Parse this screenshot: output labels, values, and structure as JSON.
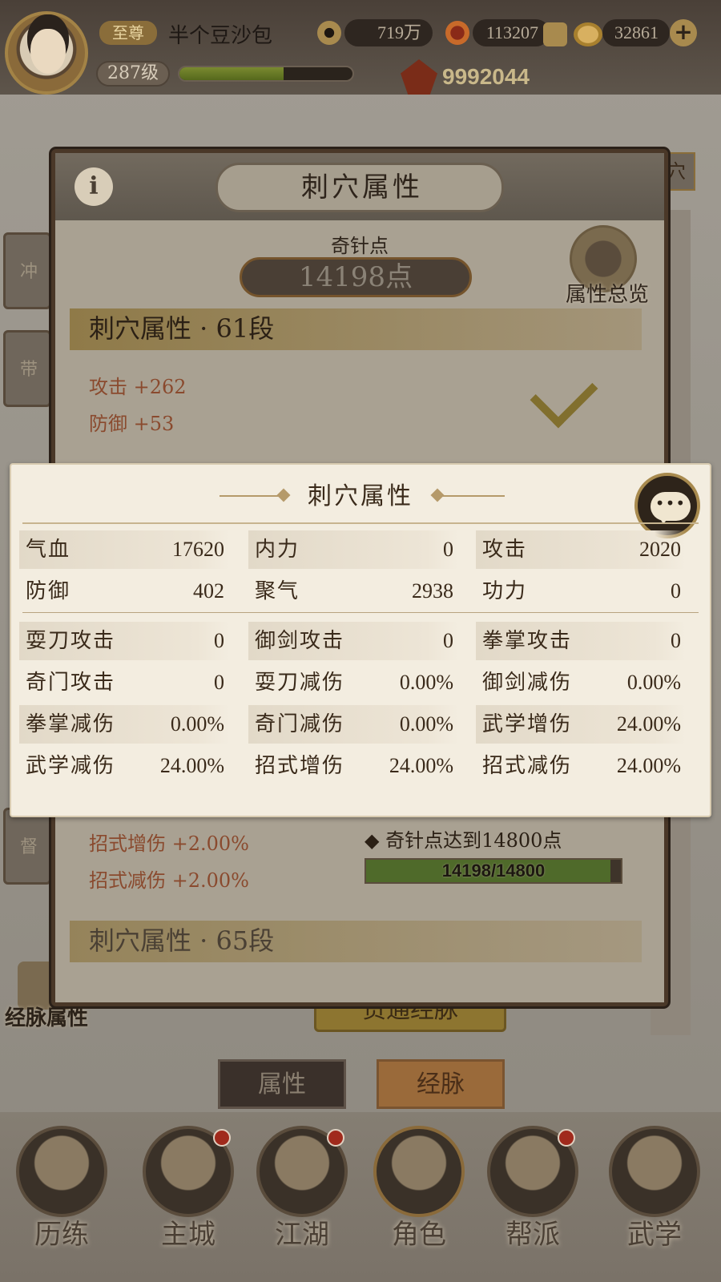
{
  "player": {
    "vip": "至尊",
    "name": "半个豆沙包",
    "level": "287级",
    "exp_fraction": 0.6,
    "copper": "719万",
    "jade": "113207",
    "gold": "32861",
    "power": "9992044"
  },
  "side": {
    "right_tab": "穴",
    "meridian_attr": "经脉属性",
    "activate_btn": "贯通经脉"
  },
  "bottom_tabs": {
    "attr": "属性",
    "meridian": "经脉"
  },
  "nav": [
    {
      "label": "历练",
      "dot": false
    },
    {
      "label": "主城",
      "dot": true
    },
    {
      "label": "江湖",
      "dot": true
    },
    {
      "label": "角色",
      "dot": false
    },
    {
      "label": "帮派",
      "dot": true
    },
    {
      "label": "武学",
      "dot": false
    }
  ],
  "dialog": {
    "title": "刺穴属性",
    "points_caption": "奇针点",
    "points_value": "14198点",
    "overview": "属性总览",
    "tier61": {
      "header": "刺穴属性 · 61段",
      "stat1": "攻击 +262",
      "stat2": "防御 +53"
    },
    "tier_mid": {
      "stat1": "招式增伤 +2.00%",
      "stat2": "招式减伤 +2.00%",
      "requirement": "◆ 奇针点达到14800点",
      "progress": "14198/14800",
      "progress_fraction": 0.959
    },
    "tier65": {
      "header": "刺穴属性 · 65段"
    }
  },
  "popup": {
    "title": "刺穴属性",
    "rows": [
      [
        {
          "name": "气血",
          "value": "17620"
        },
        {
          "name": "内力",
          "value": "0"
        },
        {
          "name": "攻击",
          "value": "2020"
        }
      ],
      [
        {
          "name": "防御",
          "value": "402"
        },
        {
          "name": "聚气",
          "value": "2938"
        },
        {
          "name": "功力",
          "value": "0"
        }
      ],
      [
        {
          "name": "耍刀攻击",
          "value": "0"
        },
        {
          "name": "御剑攻击",
          "value": "0"
        },
        {
          "name": "拳掌攻击",
          "value": "0"
        }
      ],
      [
        {
          "name": "奇门攻击",
          "value": "0"
        },
        {
          "name": "耍刀减伤",
          "value": "0.00%"
        },
        {
          "name": "御剑减伤",
          "value": "0.00%"
        }
      ],
      [
        {
          "name": "拳掌减伤",
          "value": "0.00%"
        },
        {
          "name": "奇门减伤",
          "value": "0.00%"
        },
        {
          "name": "武学增伤",
          "value": "24.00%"
        }
      ],
      [
        {
          "name": "武学减伤",
          "value": "24.00%"
        },
        {
          "name": "招式增伤",
          "value": "24.00%"
        },
        {
          "name": "招式减伤",
          "value": "24.00%"
        }
      ]
    ]
  },
  "colors": {
    "popup_bg": "#f3ede0",
    "progress_fill": "#4f6a2a",
    "stat_gain": "#8a4a2e"
  }
}
